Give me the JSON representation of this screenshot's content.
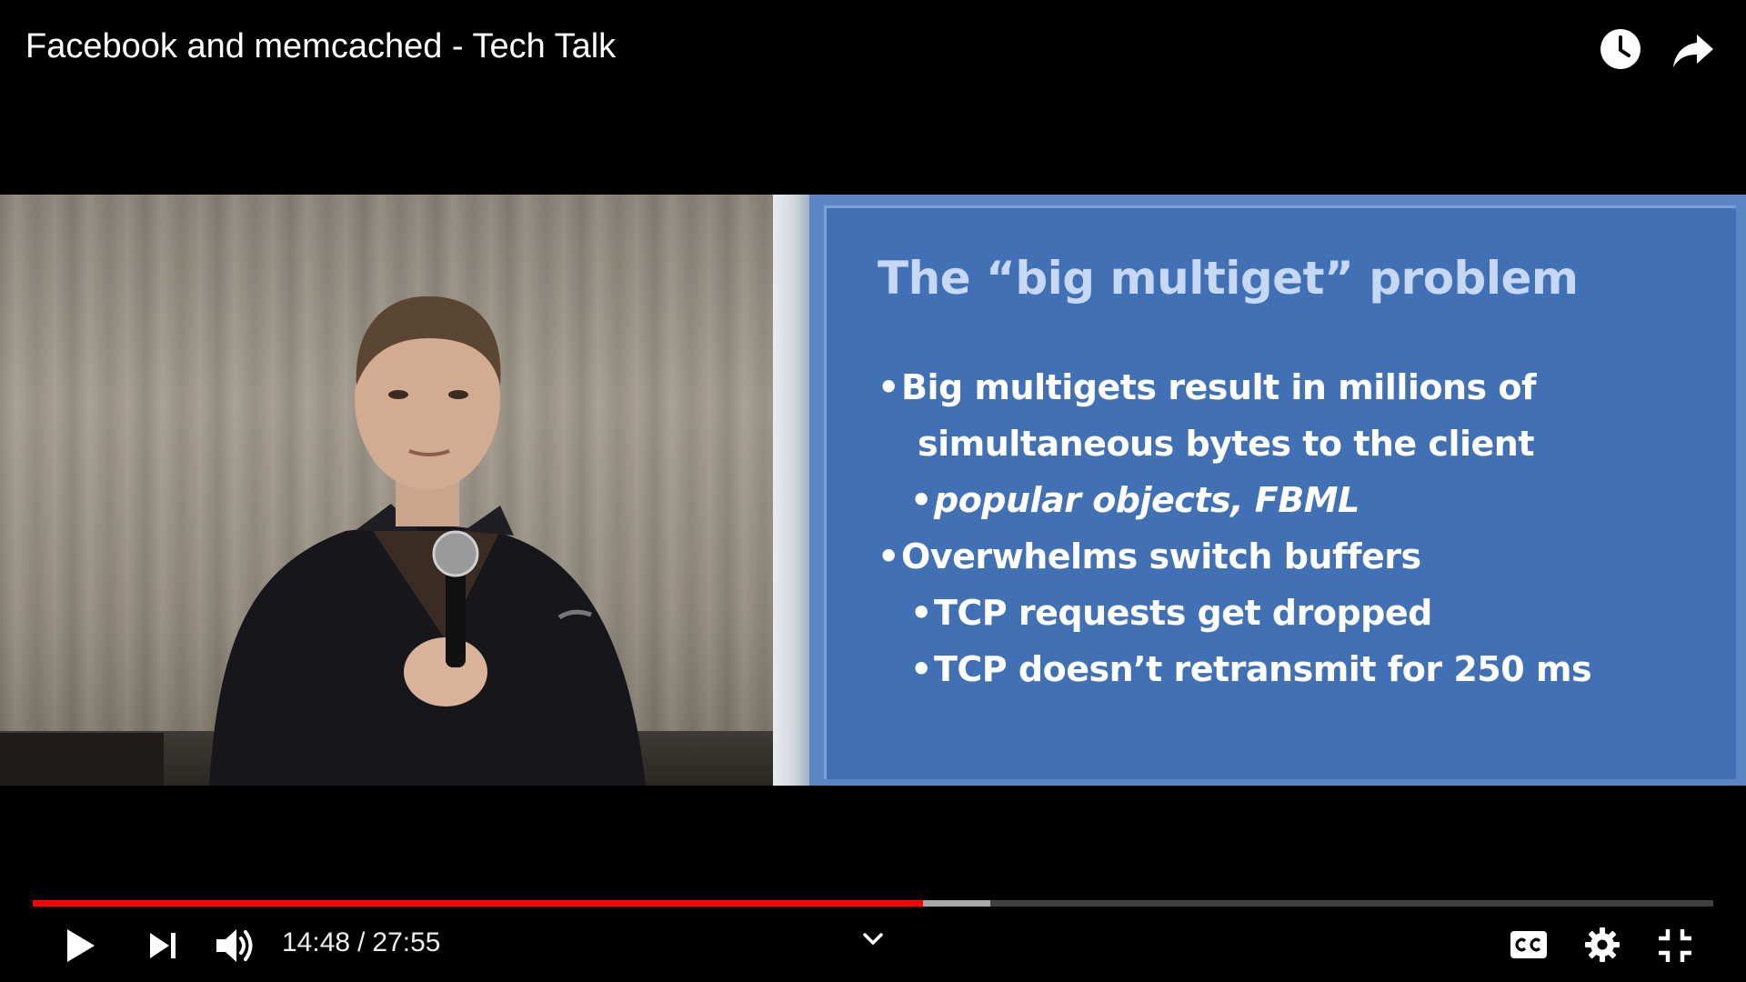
{
  "video": {
    "title": "Facebook and memcached - Tech Talk"
  },
  "top_actions": {
    "watch_later_icon": "clock-icon",
    "share_icon": "share-arrow-icon"
  },
  "slide": {
    "title": "The “big multiget” problem",
    "bullets": [
      {
        "level": 1,
        "text": "Big multigets result in millions of"
      },
      {
        "level": 1,
        "continuation": true,
        "text": "simultaneous bytes to the client"
      },
      {
        "level": 2,
        "italic": true,
        "text": "popular objects, FBML"
      },
      {
        "level": 1,
        "text": "Overwhelms switch buffers"
      },
      {
        "level": 2,
        "text": "TCP requests get dropped"
      },
      {
        "level": 2,
        "text": "TCP doesn’t retransmit for 250 ms"
      }
    ]
  },
  "playback": {
    "current_time": "14:48",
    "separator": "/",
    "duration": "27:55",
    "played_fraction": 0.53,
    "buffered_fraction": 0.57
  },
  "controls": {
    "play_icon": "play-icon",
    "next_icon": "next-icon",
    "volume_icon": "volume-icon",
    "chevron_icon": "chevron-down-icon",
    "captions_icon": "cc-icon",
    "settings_icon": "gear-icon",
    "fullscreen_exit_icon": "exit-fullscreen-icon"
  },
  "colors": {
    "progress_played": "#ff0000",
    "slide_background": "#4270b5",
    "slide_title": "#c6d8f5"
  }
}
